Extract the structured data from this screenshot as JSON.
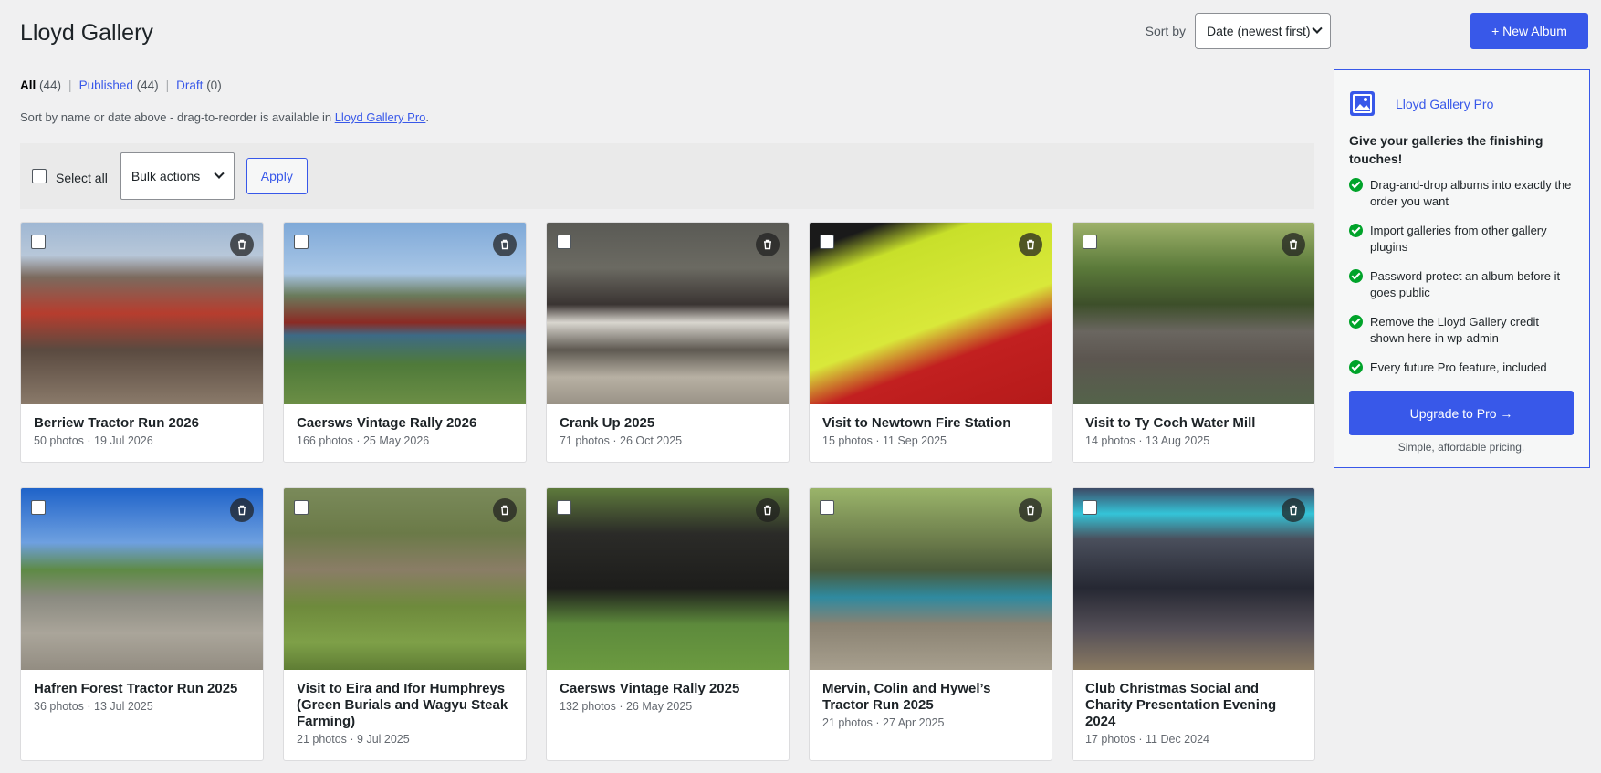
{
  "page": {
    "title": "Lloyd Gallery"
  },
  "sort": {
    "label": "Sort by",
    "value": "Date (newest first)"
  },
  "new_album_label": "+ New Album",
  "status": {
    "all_label": "All",
    "all_count": "(44)",
    "published_label": "Published",
    "published_count": "(44)",
    "draft_label": "Draft",
    "draft_count": "(0)",
    "sep": "|"
  },
  "hint": {
    "text": "Sort by name or date above - drag-to-reorder is available in ",
    "link": "Lloyd Gallery Pro",
    "suffix": "."
  },
  "bulk": {
    "select_all": "Select all",
    "actions": "Bulk actions",
    "apply": "Apply"
  },
  "albums": [
    {
      "title": "Berriew Tractor Run 2026",
      "meta": "50 photos · 19 Jul 2026"
    },
    {
      "title": "Caersws Vintage Rally 2026",
      "meta": "166 photos · 25 May 2026"
    },
    {
      "title": "Crank Up 2025",
      "meta": "71 photos · 26 Oct 2025"
    },
    {
      "title": "Visit to Newtown Fire Station",
      "meta": "15 photos · 11 Sep 2025"
    },
    {
      "title": "Visit to Ty Coch Water Mill",
      "meta": "14 photos · 13 Aug 2025"
    },
    {
      "title": "Hafren Forest Tractor Run 2025",
      "meta": "36 photos · 13 Jul 2025"
    },
    {
      "title": "Visit to Eira and Ifor Humphreys (Green Burials and Wagyu Steak Farming)",
      "meta": "21 photos · 9 Jul 2025"
    },
    {
      "title": "Caersws Vintage Rally 2025",
      "meta": "132 photos · 26 May 2025"
    },
    {
      "title": "Mervin, Colin and Hywel’s Tractor Run 2025",
      "meta": "21 photos · 27 Apr 2025"
    },
    {
      "title": "Club Christmas Social and Charity Presentation Evening 2024",
      "meta": "17 photos · 11 Dec 2024"
    }
  ],
  "promo": {
    "name": "Lloyd Gallery Pro",
    "lead": "Give your galleries the finishing touches!",
    "features": [
      "Drag-and-drop albums into exactly the order you want",
      "Import galleries from other gallery plugins",
      "Password protect an album before it goes public",
      "Remove the Lloyd Gallery credit shown here in wp-admin",
      "Every future Pro feature, included"
    ],
    "cta": "Upgrade to Pro →",
    "pricing": "Simple, affordable pricing."
  },
  "colors": {
    "accent": "#3858e9",
    "success": "#00a32a",
    "background": "#f0f0f1"
  },
  "icons": {
    "trash": "trash-icon",
    "logo": "gallery-image-icon",
    "check": "check-circle-icon",
    "chevron": "chevron-down-icon"
  }
}
